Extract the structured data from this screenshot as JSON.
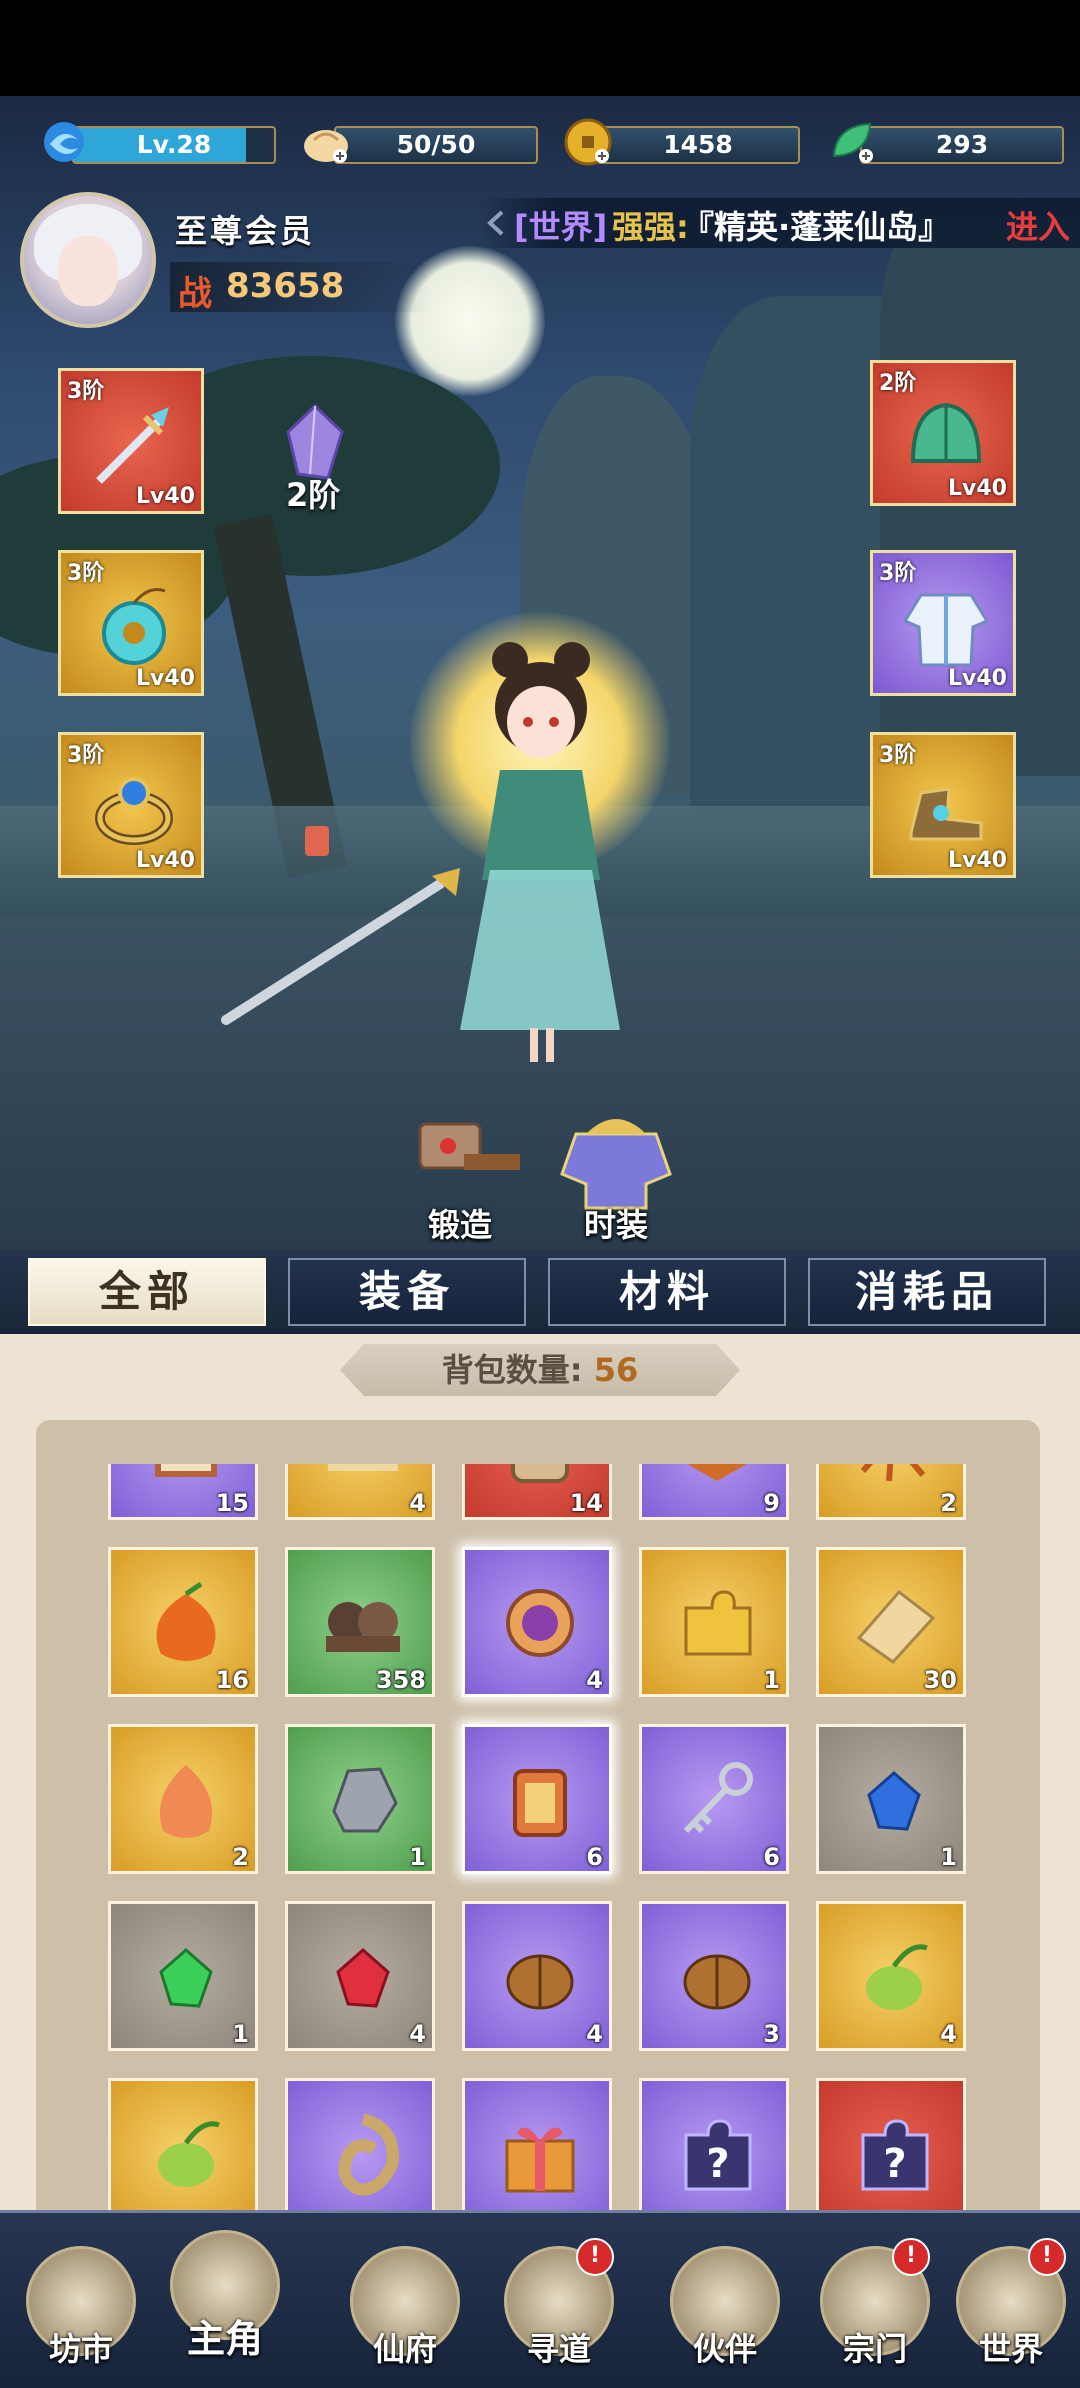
{
  "resources": {
    "level": "Lv.28",
    "stamina": "50/50",
    "coins": "1458",
    "jade": "293"
  },
  "player": {
    "vip_title": "至尊会员",
    "power_label": "战",
    "power_value": "83658"
  },
  "world_message": {
    "channel": "[世界]",
    "sender": "强强:",
    "text": "『精英·蓬莱仙岛』",
    "action": "进入"
  },
  "equipment": {
    "weapon": {
      "tier": "3阶",
      "level": "Lv40"
    },
    "pendant": {
      "tier": "3阶",
      "level": "Lv40"
    },
    "ring": {
      "tier": "3阶",
      "level": "Lv40"
    },
    "helmet": {
      "tier": "2阶",
      "level": "Lv40"
    },
    "armor": {
      "tier": "3阶",
      "level": "Lv40"
    },
    "boots": {
      "tier": "3阶",
      "level": "Lv40"
    },
    "gem_tier": "2阶"
  },
  "actions": {
    "forge": "锻造",
    "fashion": "时装"
  },
  "tabs": [
    "全部",
    "装备",
    "材料",
    "消耗品"
  ],
  "bag": {
    "count_label": "背包数量:",
    "count_value": "56",
    "items": [
      {
        "count": "15",
        "rarity": "purple",
        "icon": "book-icon"
      },
      {
        "count": "4",
        "rarity": "gold",
        "icon": "scroll-icon"
      },
      {
        "count": "14",
        "rarity": "red",
        "icon": "token-icon"
      },
      {
        "count": "9",
        "rarity": "purple",
        "icon": "leaf-icon"
      },
      {
        "count": "2",
        "rarity": "gold",
        "icon": "root-icon"
      },
      {
        "count": "16",
        "rarity": "gold",
        "icon": "fruit-icon"
      },
      {
        "count": "358",
        "rarity": "green",
        "icon": "stone-icon"
      },
      {
        "count": "4",
        "rarity": "purple",
        "icon": "xuan-medal-icon"
      },
      {
        "count": "1",
        "rarity": "gold",
        "icon": "puzzle-icon"
      },
      {
        "count": "30",
        "rarity": "gold",
        "icon": "puzzle-piece-icon"
      },
      {
        "count": "2",
        "rarity": "gold",
        "icon": "flower-bud-icon"
      },
      {
        "count": "1",
        "rarity": "green",
        "icon": "ore-icon"
      },
      {
        "count": "6",
        "rarity": "purple",
        "icon": "xian-talisman-icon"
      },
      {
        "count": "6",
        "rarity": "purple",
        "icon": "key-icon"
      },
      {
        "count": "1",
        "rarity": "gray",
        "icon": "blue-gem-icon"
      },
      {
        "count": "1",
        "rarity": "gray",
        "icon": "green-gem-icon"
      },
      {
        "count": "4",
        "rarity": "gray",
        "icon": "red-gem-icon"
      },
      {
        "count": "4",
        "rarity": "purple",
        "icon": "seed-icon"
      },
      {
        "count": "3",
        "rarity": "purple",
        "icon": "seed-icon"
      },
      {
        "count": "4",
        "rarity": "gold",
        "icon": "sprout-icon"
      },
      {
        "count": "",
        "rarity": "gold",
        "icon": "sprout-icon"
      },
      {
        "count": "",
        "rarity": "purple",
        "icon": "shell-icon"
      },
      {
        "count": "",
        "rarity": "purple",
        "icon": "gift-box-icon"
      },
      {
        "count": "",
        "rarity": "purple",
        "icon": "mystery-puzzle-icon"
      },
      {
        "count": "",
        "rarity": "red",
        "icon": "mystery-puzzle-icon"
      }
    ]
  },
  "nav": [
    {
      "label": "坊市",
      "badge": false
    },
    {
      "label": "主角",
      "badge": false
    },
    {
      "label": "仙府",
      "badge": false
    },
    {
      "label": "寻道",
      "badge": true
    },
    {
      "label": "伙伴",
      "badge": false
    },
    {
      "label": "宗门",
      "badge": true
    },
    {
      "label": "世界",
      "badge": true
    }
  ],
  "badge_symbol": "!"
}
